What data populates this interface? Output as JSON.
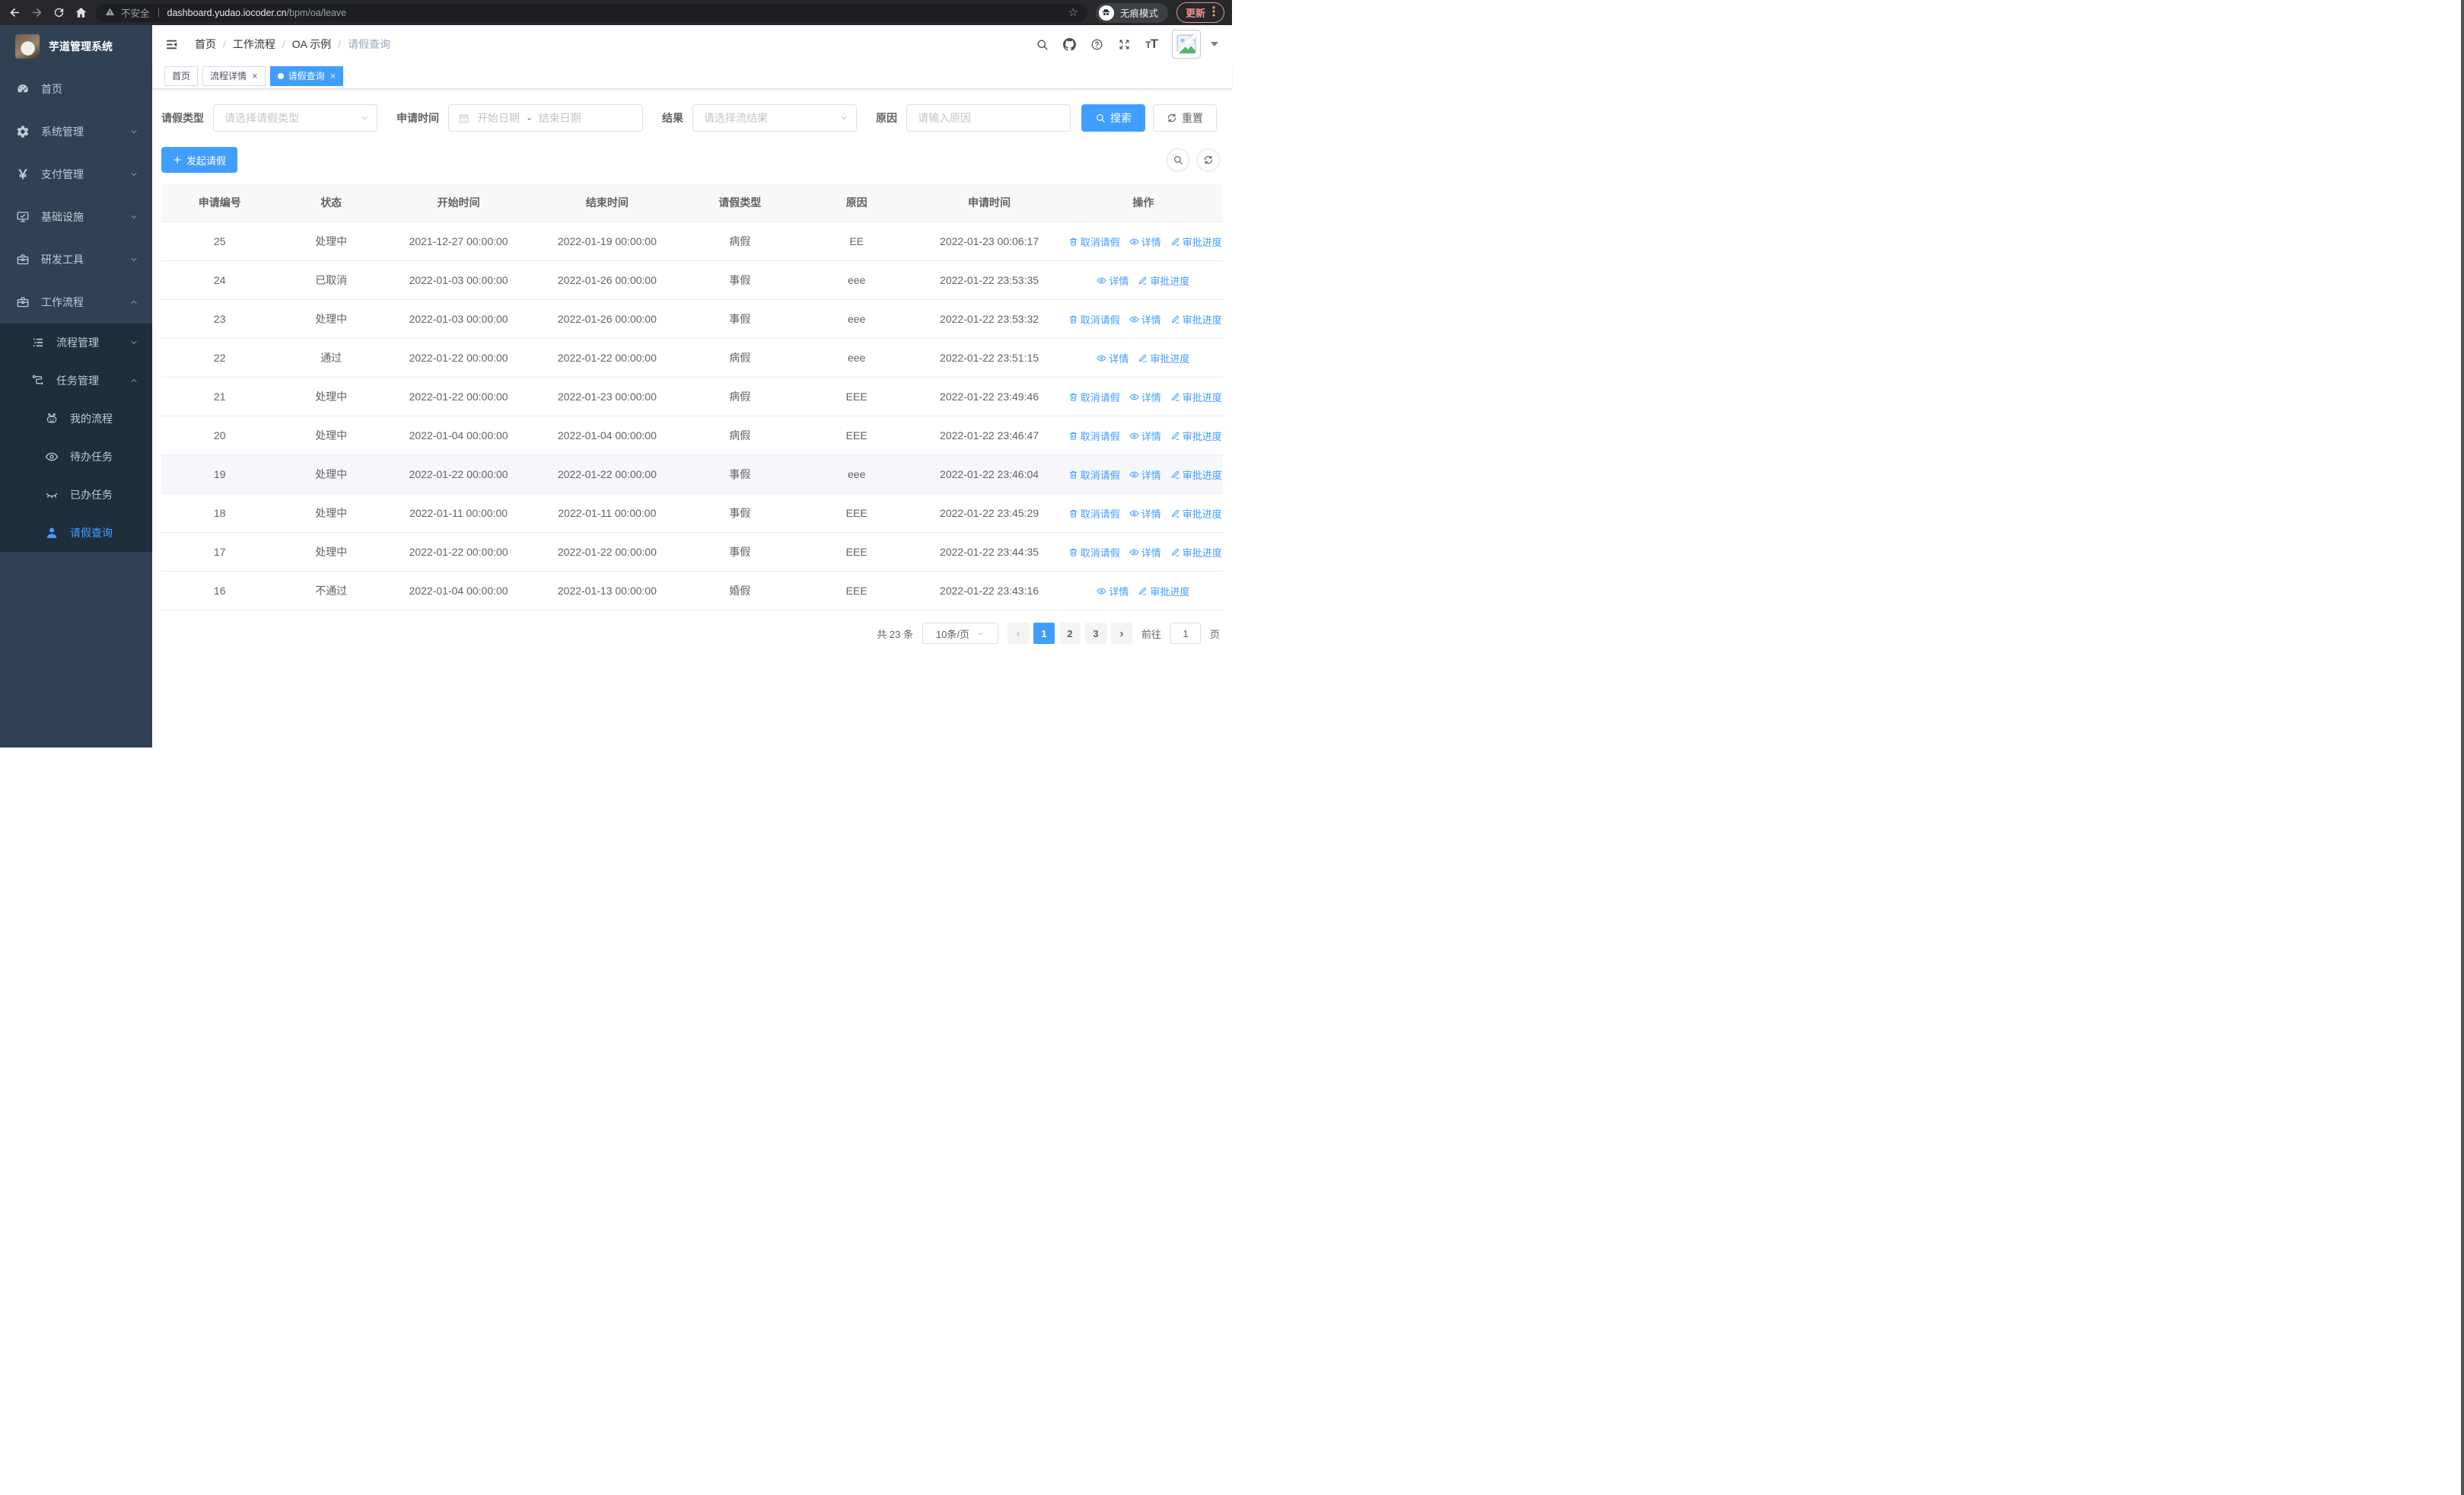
{
  "browser": {
    "security": "不安全",
    "url_domain": "dashboard.yudao.iocoder.cn",
    "url_path": "/bpm/oa/leave",
    "incognito": "无痕模式",
    "update": "更新"
  },
  "sidebar": {
    "title": "芋道管理系统",
    "menu": [
      {
        "id": "home",
        "label": "首页",
        "icon": "dashboard-icon",
        "level": 1
      },
      {
        "id": "system",
        "label": "系统管理",
        "icon": "gear-icon",
        "level": 1,
        "chevron": "down"
      },
      {
        "id": "payment",
        "label": "支付管理",
        "icon": "yen-icon",
        "level": 1,
        "chevron": "down"
      },
      {
        "id": "infrastructure",
        "label": "基础设施",
        "icon": "monitor-icon",
        "level": 1,
        "chevron": "down"
      },
      {
        "id": "dev-tools",
        "label": "研发工具",
        "icon": "toolbox-icon",
        "level": 1,
        "chevron": "down"
      },
      {
        "id": "workflow",
        "label": "工作流程",
        "icon": "toolbox-icon",
        "level": 1,
        "chevron": "up"
      },
      {
        "id": "process-mgmt",
        "label": "流程管理",
        "icon": "list-icon",
        "level": 2,
        "chevron": "down",
        "dark": true
      },
      {
        "id": "task-mgmt",
        "label": "任务管理",
        "icon": "flow-icon",
        "level": 2,
        "chevron": "up",
        "dark": true
      },
      {
        "id": "my-process",
        "label": "我的流程",
        "icon": "robot-icon",
        "level": 3,
        "dark": true
      },
      {
        "id": "todo-task",
        "label": "待办任务",
        "icon": "eye-open-icon",
        "level": 3,
        "dark": true
      },
      {
        "id": "done-task",
        "label": "已办任务",
        "icon": "eye-closed-icon",
        "level": 3,
        "dark": true
      },
      {
        "id": "leave-query",
        "label": "请假查询",
        "icon": "user-icon",
        "level": 3,
        "dark": true,
        "active": true
      }
    ]
  },
  "navbar": {
    "breadcrumb": [
      "首页",
      "工作流程",
      "OA 示例",
      "请假查询"
    ]
  },
  "tabs": [
    {
      "id": "home",
      "label": "首页",
      "closable": false,
      "active": false
    },
    {
      "id": "process-detail",
      "label": "流程详情",
      "closable": true,
      "active": false
    },
    {
      "id": "leave-query",
      "label": "请假查询",
      "closable": true,
      "active": true
    }
  ],
  "filters": {
    "type": {
      "label": "请假类型",
      "placeholder": "请选择请假类型"
    },
    "time": {
      "label": "申请时间",
      "start_placeholder": "开始日期",
      "separator": "-",
      "end_placeholder": "结束日期"
    },
    "result": {
      "label": "结果",
      "placeholder": "请选择流结果"
    },
    "reason": {
      "label": "原因",
      "placeholder": "请输入原因"
    },
    "search_label": "搜索",
    "reset_label": "重置"
  },
  "toolbar": {
    "create_label": "发起请假"
  },
  "table": {
    "headers": [
      "申请编号",
      "状态",
      "开始时间",
      "结束时间",
      "请假类型",
      "原因",
      "申请时间",
      "操作"
    ],
    "action_defs": {
      "cancel": {
        "label": "取消请假",
        "icon": "trash-icon"
      },
      "detail": {
        "label": "详情",
        "icon": "view-icon"
      },
      "progress": {
        "label": "审批进度",
        "icon": "edit-icon"
      }
    },
    "rows": [
      {
        "id": "25",
        "status": "处理中",
        "start_time": "2021-12-27 00:00:00",
        "end_time": "2022-01-19 00:00:00",
        "leave_type": "病假",
        "reason": "EE",
        "apply_time": "2022-01-23 00:06:17",
        "actions": [
          "cancel",
          "detail",
          "progress"
        ]
      },
      {
        "id": "24",
        "status": "已取消",
        "start_time": "2022-01-03 00:00:00",
        "end_time": "2022-01-26 00:00:00",
        "leave_type": "事假",
        "reason": "eee",
        "apply_time": "2022-01-22 23:53:35",
        "actions": [
          "detail",
          "progress"
        ]
      },
      {
        "id": "23",
        "status": "处理中",
        "start_time": "2022-01-03 00:00:00",
        "end_time": "2022-01-26 00:00:00",
        "leave_type": "事假",
        "reason": "eee",
        "apply_time": "2022-01-22 23:53:32",
        "actions": [
          "cancel",
          "detail",
          "progress"
        ]
      },
      {
        "id": "22",
        "status": "通过",
        "start_time": "2022-01-22 00:00:00",
        "end_time": "2022-01-22 00:00:00",
        "leave_type": "病假",
        "reason": "eee",
        "apply_time": "2022-01-22 23:51:15",
        "actions": [
          "detail",
          "progress"
        ]
      },
      {
        "id": "21",
        "status": "处理中",
        "start_time": "2022-01-22 00:00:00",
        "end_time": "2022-01-23 00:00:00",
        "leave_type": "病假",
        "reason": "EEE",
        "apply_time": "2022-01-22 23:49:46",
        "actions": [
          "cancel",
          "detail",
          "progress"
        ]
      },
      {
        "id": "20",
        "status": "处理中",
        "start_time": "2022-01-04 00:00:00",
        "end_time": "2022-01-04 00:00:00",
        "leave_type": "病假",
        "reason": "EEE",
        "apply_time": "2022-01-22 23:46:47",
        "actions": [
          "cancel",
          "detail",
          "progress"
        ]
      },
      {
        "id": "19",
        "status": "处理中",
        "start_time": "2022-01-22 00:00:00",
        "end_time": "2022-01-22 00:00:00",
        "leave_type": "事假",
        "reason": "eee",
        "apply_time": "2022-01-22 23:46:04",
        "actions": [
          "cancel",
          "detail",
          "progress"
        ],
        "highlighted": true
      },
      {
        "id": "18",
        "status": "处理中",
        "start_time": "2022-01-11 00:00:00",
        "end_time": "2022-01-11 00:00:00",
        "leave_type": "事假",
        "reason": "EEE",
        "apply_time": "2022-01-22 23:45:29",
        "actions": [
          "cancel",
          "detail",
          "progress"
        ]
      },
      {
        "id": "17",
        "status": "处理中",
        "start_time": "2022-01-22 00:00:00",
        "end_time": "2022-01-22 00:00:00",
        "leave_type": "事假",
        "reason": "EEE",
        "apply_time": "2022-01-22 23:44:35",
        "actions": [
          "cancel",
          "detail",
          "progress"
        ]
      },
      {
        "id": "16",
        "status": "不通过",
        "start_time": "2022-01-04 00:00:00",
        "end_time": "2022-01-13 00:00:00",
        "leave_type": "婚假",
        "reason": "EEE",
        "apply_time": "2022-01-22 23:43:16",
        "actions": [
          "detail",
          "progress"
        ]
      }
    ]
  },
  "pagination": {
    "total": "共 23 条",
    "page_size": "10条/页",
    "pages": [
      "1",
      "2",
      "3"
    ],
    "active_page": "1",
    "prev_glyph": "‹",
    "next_glyph": "›",
    "goto_label": "前往",
    "goto_value": "1",
    "goto_unit": "页"
  }
}
